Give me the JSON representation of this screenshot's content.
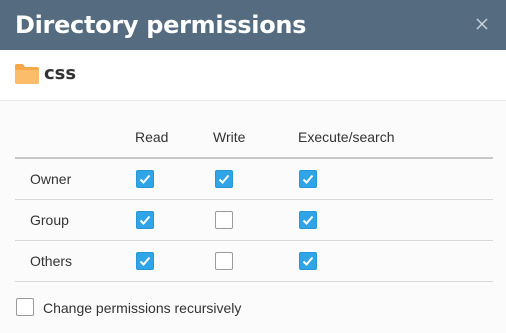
{
  "dialog": {
    "title": "Directory permissions",
    "directory_name": "css"
  },
  "columns": [
    "Read",
    "Write",
    "Execute/search"
  ],
  "rows": [
    {
      "label": "Owner",
      "read": true,
      "write": true,
      "execute": true
    },
    {
      "label": "Group",
      "read": true,
      "write": false,
      "execute": true
    },
    {
      "label": "Others",
      "read": true,
      "write": false,
      "execute": true
    }
  ],
  "recursive": {
    "label": "Change permissions recursively",
    "checked": false
  },
  "colors": {
    "titlebar": "#546b80",
    "checkbox_checked": "#2fa4e7",
    "folder": "#f5a94a"
  },
  "icons": {
    "close": "close-icon",
    "folder": "folder-icon",
    "check": "checkmark-icon"
  }
}
